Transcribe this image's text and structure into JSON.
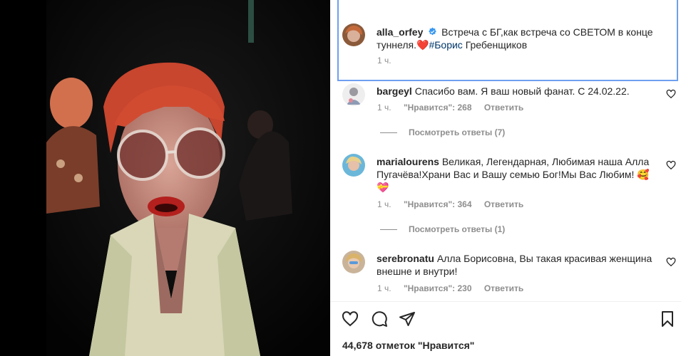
{
  "post": {
    "author": "alla_orfey",
    "caption_text": "Встреча с БГ,как встреча со СВЕТОМ в конце туннеля.❤️",
    "caption_hashtag": "#Борис",
    "caption_after": " Гребенщиков",
    "caption_time": "1 ч.",
    "verified_icon": "verified-badge-icon"
  },
  "comments": [
    {
      "username": "bargeyl",
      "text": "Спасибо вам. Я ваш новый фанат. С 24.02.22.",
      "time": "1 ч.",
      "likes": "\"Нравится\": 268",
      "reply": "Ответить",
      "view_replies": "Посмотреть ответы (7)"
    },
    {
      "username": "marialourens",
      "text": "Великая, Легендарная, Любимая наша Алла Пугачёва!Храни Вас и Вашу семью Бог!Мы Вас Любим! 🥰💝",
      "time": "1 ч.",
      "likes": "\"Нравится\": 364",
      "reply": "Ответить",
      "view_replies": "Посмотреть ответы (1)"
    },
    {
      "username": "serebronatu",
      "text": "Алла Борисовна, Вы такая красивая женщина внешне и внутри!",
      "time": "1 ч.",
      "likes": "\"Нравится\": 230",
      "reply": "Ответить"
    }
  ],
  "actions": {
    "like_icon": "heart-icon",
    "comment_icon": "comment-icon",
    "share_icon": "send-icon",
    "save_icon": "bookmark-icon"
  },
  "likes_count": "44,678 отметок \"Нравится\"",
  "colors": {
    "link": "#00376b",
    "muted": "#8e8e8e",
    "focus_border": "#6e9ff0"
  }
}
